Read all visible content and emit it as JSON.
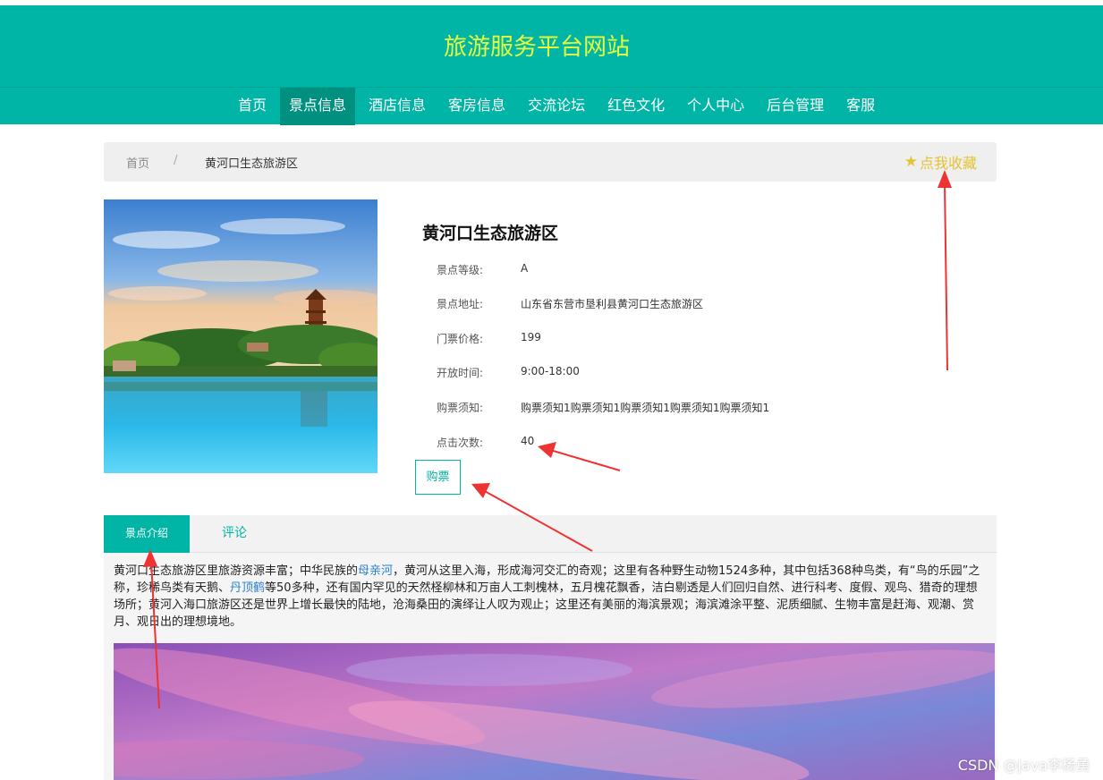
{
  "site": {
    "title": "旅游服务平台网站"
  },
  "nav": {
    "items": [
      {
        "label": "首页",
        "active": false
      },
      {
        "label": "景点信息",
        "active": true
      },
      {
        "label": "酒店信息",
        "active": false
      },
      {
        "label": "客房信息",
        "active": false
      },
      {
        "label": "交流论坛",
        "active": false
      },
      {
        "label": "红色文化",
        "active": false
      },
      {
        "label": "个人中心",
        "active": false
      },
      {
        "label": "后台管理",
        "active": false
      },
      {
        "label": "客服",
        "active": false
      }
    ]
  },
  "breadcrumb": {
    "home": "首页",
    "separator": "/",
    "current": "黄河口生态旅游区"
  },
  "favorite": {
    "label": "点我收藏",
    "icon": "star-icon"
  },
  "detail": {
    "title": "黄河口生态旅游区",
    "rows": [
      {
        "label": "景点等级:",
        "value": "A"
      },
      {
        "label": "景点地址:",
        "value": "山东省东营市垦利县黄河口生态旅游区"
      },
      {
        "label": "门票价格:",
        "value": "199"
      },
      {
        "label": "开放时间:",
        "value": "9:00-18:00"
      },
      {
        "label": "购票须知:",
        "value": "购票须知1购票须知1购票须知1购票须知1购票须知1"
      },
      {
        "label": "点击次数:",
        "value": "40"
      }
    ],
    "buy_label": "购票"
  },
  "tabs": {
    "intro": "景点介绍",
    "comment": "评论"
  },
  "intro": {
    "part1": "黄河口生态旅游区里旅游资源丰富；中华民族的",
    "link1": "母亲河",
    "part2": "，黄河从这里入海，形成海河交汇的奇观；这里有各种野生动物1524多种，其中包括368种鸟类，有“鸟的乐园”之称，珍稀鸟类有天鹅、",
    "link2": "丹顶鹤",
    "part3": "等50多种，还有国内罕见的天然柽柳林和万亩人工刺槐林，五月槐花飘香，洁白剔透是人们回归自然、进行科考、度假、观鸟、猎奇的理想场所；黄河入海口旅游区还是世界上增长最快的陆地，沧海桑田的演绎让人叹为观止；这里还有美丽的海滨景观；海滨滩涂平整、泥质细腻、生物丰富是赶海、观潮、赏月、观日出的理想境地。"
  },
  "watermark": "CSDN @java李杨勇",
  "colors": {
    "brand": "#00b5a5",
    "title": "#e6ff3c",
    "favorite": "#e4c432",
    "link": "#2a7fcf",
    "arrow": "#ee3333"
  }
}
